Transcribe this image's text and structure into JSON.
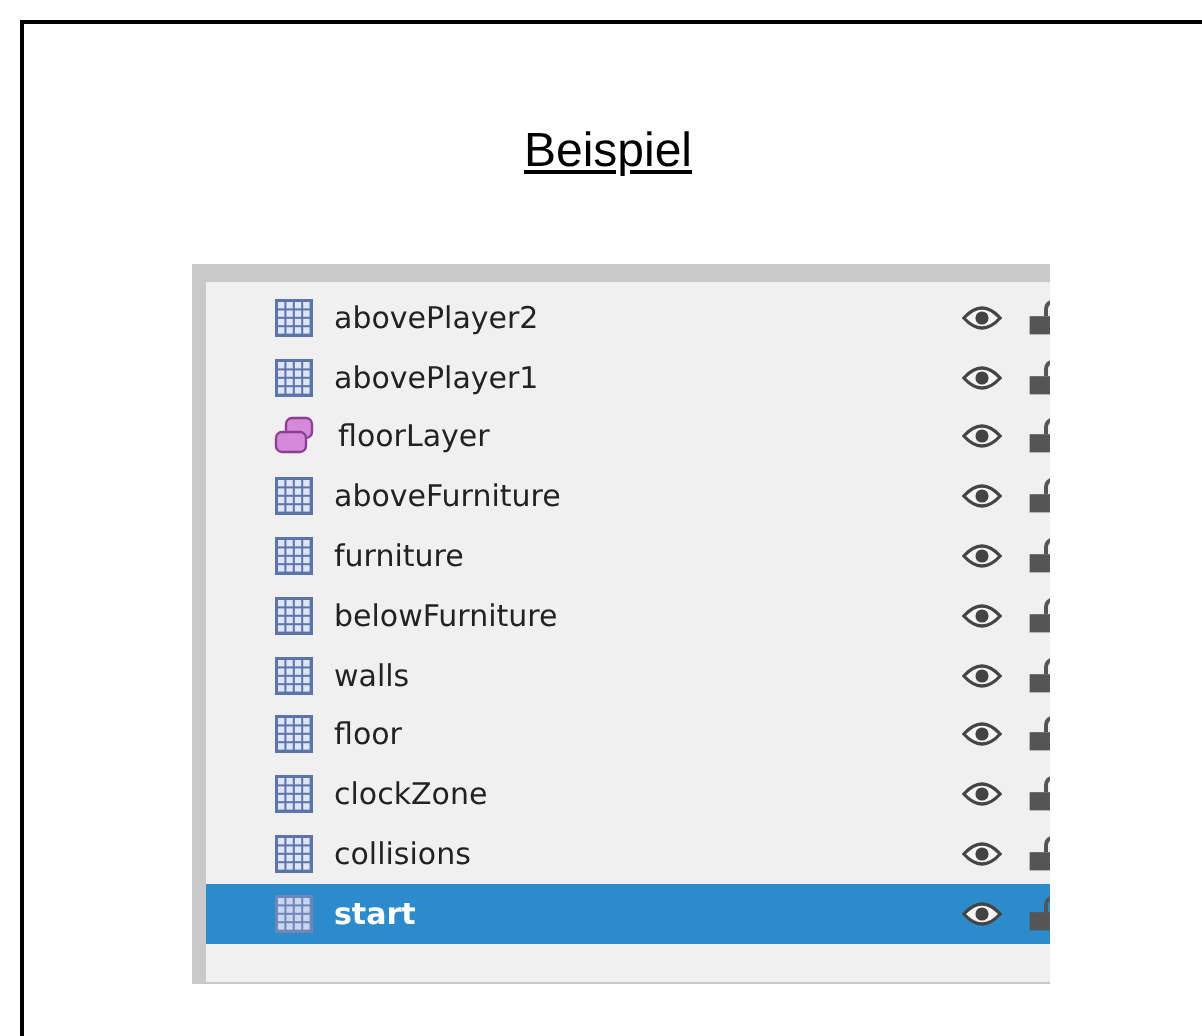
{
  "title": "Beispiel",
  "layers": [
    {
      "name": "abovePlayer2",
      "kind": "tile",
      "visible": true,
      "locked": false,
      "selected": false
    },
    {
      "name": "abovePlayer1",
      "kind": "tile",
      "visible": true,
      "locked": false,
      "selected": false
    },
    {
      "name": "floorLayer",
      "kind": "object",
      "visible": true,
      "locked": false,
      "selected": false
    },
    {
      "name": "aboveFurniture",
      "kind": "tile",
      "visible": true,
      "locked": false,
      "selected": false
    },
    {
      "name": "furniture",
      "kind": "tile",
      "visible": true,
      "locked": false,
      "selected": false
    },
    {
      "name": "belowFurniture",
      "kind": "tile",
      "visible": true,
      "locked": false,
      "selected": false
    },
    {
      "name": "walls",
      "kind": "tile",
      "visible": true,
      "locked": false,
      "selected": false
    },
    {
      "name": "floor",
      "kind": "tile",
      "visible": true,
      "locked": false,
      "selected": false
    },
    {
      "name": "clockZone",
      "kind": "tile",
      "visible": true,
      "locked": false,
      "selected": false
    },
    {
      "name": "collisions",
      "kind": "tile",
      "visible": true,
      "locked": false,
      "selected": false
    },
    {
      "name": "start",
      "kind": "tile",
      "visible": true,
      "locked": false,
      "selected": true
    }
  ]
}
